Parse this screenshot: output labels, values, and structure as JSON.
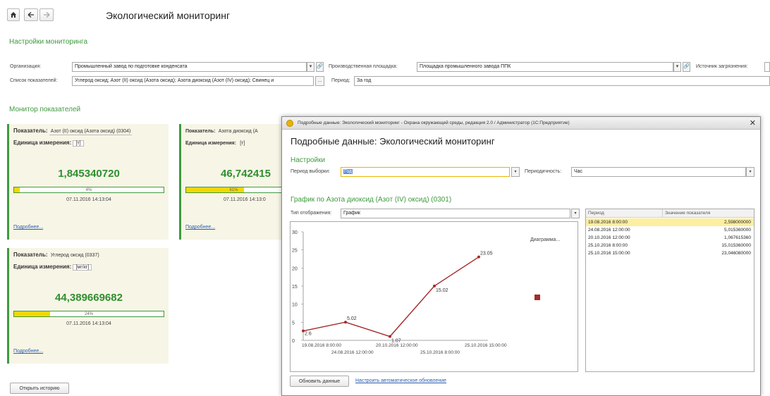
{
  "header": {
    "title": "Экологический мониторинг",
    "home_icon": "home-icon",
    "back_icon": "arrow-left-icon",
    "forward_icon": "arrow-right-icon"
  },
  "settings": {
    "title": "Настройки мониторинга",
    "org_label": "Организация:",
    "org_value": "Промышленный завод по подготовке конденсата",
    "site_label": "Производственная площадка:",
    "site_value": "Площадка промышленного завода ППК",
    "source_label": "Источник загрязнения:",
    "indicators_label": "Список показателей:",
    "indicators_value": "Углерод оксид; Азот (II) оксид (Азота оксид); Азота диоксид (Азот (IV) оксид); Свинец и",
    "ellipsis": "...",
    "period_label": "Период:",
    "period_value": "За год"
  },
  "monitor": {
    "title": "Монитор показателей",
    "indicator_label": "Показатель:",
    "unit_label": "Единица измерения:",
    "more_link": "Подробнее...",
    "cards": [
      {
        "indicator": "Азот (II) оксид (Азота оксид) (0304)",
        "unit": "[т]",
        "value": "1,845340720",
        "percent": "4%",
        "fill": 0.04,
        "date": "07.11.2016 14:13:04"
      },
      {
        "indicator": "Азота диоксид (А",
        "unit": "[т]",
        "value": "46,742415",
        "percent": "61%",
        "fill": 0.61,
        "date": "07.11.2016 14:13:0"
      },
      {
        "indicator": "Углерод оксид (0337)",
        "unit": "[мг/кг]",
        "value": "44,389669682",
        "percent": "24%",
        "fill": 0.24,
        "date": "07.11.2016 14:13:04"
      }
    ],
    "history_button": "Открыть историю"
  },
  "dialog": {
    "window_title": "Подробные данные: Экологический мониторинг - Охрана окружающей среды, редакция 2.0 / Администратор (1С:Предприятие)",
    "close_icon": "close-icon",
    "heading": "Подробные данные: Экологический мониторинг",
    "settings_title": "Настройки",
    "period_label": "Период выборки:",
    "period_value": "Год",
    "periodicity_label": "Периодичность:",
    "periodicity_value": "Час",
    "chart_title": "График по Азота диоксид (Азот (IV) оксид) (0301)",
    "display_type_label": "Тип отображения:",
    "display_type_value": "График",
    "table": {
      "col_period": "Период",
      "col_value": "Значение показателя",
      "rows": [
        {
          "period": "19.08.2016 8:00:00",
          "value": "2,598000000",
          "selected": true
        },
        {
          "period": "24.08.2016 12:00:00",
          "value": "5,015360000",
          "selected": false
        },
        {
          "period": "20.10.2016 12:00:00",
          "value": "1,067615360",
          "selected": false
        },
        {
          "period": "25.10.2016 8:00:00",
          "value": "15,015360000",
          "selected": false
        },
        {
          "period": "25.10.2016 15:00:00",
          "value": "23,046080000",
          "selected": false
        }
      ]
    },
    "refresh_button": "Обновить данные",
    "auto_refresh_link": "Настроить автоматическое обновление"
  },
  "chart_data": {
    "type": "line",
    "title": "",
    "legend_label": "Диаграмма...",
    "x": [
      "19.08.2016 8:00:00",
      "24.08.2016 12:00:00",
      "20.10.2016 12:00:00",
      "25.10.2016 8:00:00",
      "25.10.2016 15:00:00"
    ],
    "x_tick_labels": [
      "19.08.2016 8:00:00",
      "24.08.2016 12:00:00",
      "20.10.2016 12:00:00",
      "25.10.2016 8:00:00",
      "25.10.2016 15:00:00"
    ],
    "series": [
      {
        "values": [
          2.6,
          5.02,
          1.07,
          15.02,
          23.05
        ],
        "labels": [
          "2.6",
          "5.02",
          "1.07",
          "15.02",
          "23.05"
        ],
        "color": "#a52a2a"
      }
    ],
    "ylim": [
      0,
      30
    ],
    "yticks": [
      0,
      5,
      10,
      15,
      20,
      25,
      30
    ],
    "grid": false,
    "legend_position": "right"
  },
  "colors": {
    "accent_green": "#3f9a3f",
    "series": "#a52a2a",
    "progress": "#f5d800",
    "selected_row": "#fdeea0"
  }
}
